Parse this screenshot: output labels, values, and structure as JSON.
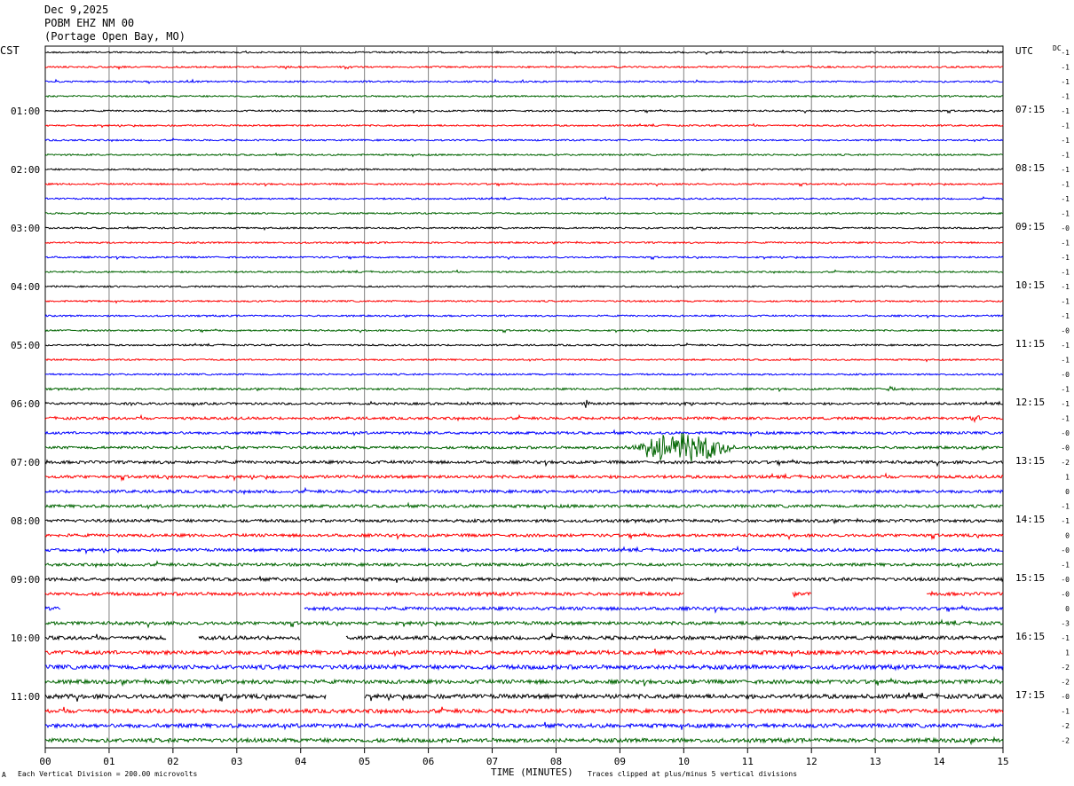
{
  "header": {
    "date": "Dec 9,2025",
    "station": "POBM EHZ NM 00",
    "location": "(Portage Open Bay, MO)"
  },
  "left_axis_label": "CST",
  "right_axis_label": "UTC",
  "dc_label": "DC",
  "footer": {
    "scale_note": "Each Vertical Division =  200.00 microvolts",
    "xlabel": "TIME (MINUTES)",
    "clip_note": "Traces clipped at plus/minus 5 vertical divisions",
    "corner_mark": "A"
  },
  "colors": {
    "trace_cycle": [
      "#000000",
      "#ff0000",
      "#0000ff",
      "#006400"
    ],
    "grid": "#808080",
    "background": "#ffffff"
  },
  "chart_data": {
    "type": "line",
    "xlabel": "TIME (MINUTES)",
    "xlim": [
      0,
      15
    ],
    "x_ticks": [
      "00",
      "01",
      "02",
      "03",
      "04",
      "05",
      "06",
      "07",
      "08",
      "09",
      "10",
      "11",
      "12",
      "13",
      "14",
      "15"
    ],
    "row_count": 48,
    "row_minutes": 15,
    "left_time_labels": [
      "01:00",
      "02:00",
      "03:00",
      "04:00",
      "05:00",
      "06:00",
      "07:00",
      "08:00",
      "09:00",
      "10:00",
      "11:00"
    ],
    "left_label_rows": [
      4,
      8,
      12,
      16,
      20,
      24,
      28,
      32,
      36,
      40,
      44
    ],
    "right_time_labels": [
      "UTC",
      "07:15",
      "08:15",
      "09:15",
      "10:15",
      "11:15",
      "12:15",
      "13:15",
      "14:15",
      "15:15",
      "16:15",
      "17:15"
    ],
    "right_label_rows": [
      0,
      4,
      8,
      12,
      16,
      20,
      24,
      28,
      32,
      36,
      40,
      44
    ],
    "dc_offsets": [
      "-1",
      "-1",
      "-1",
      "-1",
      "-1",
      "-1",
      "-1",
      "-1",
      "-1",
      "-1",
      "-1",
      "-1",
      "-0",
      "-1",
      "-1",
      "-1",
      "-1",
      "-1",
      "-1",
      "-0",
      "-1",
      "-1",
      "-0",
      "-1",
      "-1",
      "-1",
      "-0",
      "-0",
      "-2",
      "1",
      "0",
      "-1",
      "-1",
      "0",
      "-0",
      "-1",
      "-0",
      "-0",
      "0",
      "-3",
      "-1",
      "1",
      "-2",
      "-2",
      "-0",
      "-1",
      "-2",
      "-2"
    ],
    "noise_level": [
      1,
      1,
      1,
      1,
      1,
      1,
      1,
      1,
      1,
      1,
      1,
      1,
      1,
      1,
      1,
      1,
      1,
      1,
      1,
      1,
      1,
      1,
      1,
      1.2,
      1.4,
      1.6,
      1.6,
      1.6,
      1.8,
      1.8,
      1.8,
      1.8,
      1.8,
      1.8,
      1.8,
      1.8,
      2,
      2,
      2,
      2,
      2.2,
      2.4,
      2.6,
      2.4,
      2.6,
      2.4,
      2.4,
      2.4
    ],
    "events": [
      {
        "row": 27,
        "start_min": 9.05,
        "end_min": 10.85,
        "peak_divisions": 5
      },
      {
        "row": 24,
        "start_min": 8.4,
        "end_min": 8.55,
        "peak_divisions": 1.5
      },
      {
        "row": 24,
        "start_min": 9.9,
        "end_min": 10.15,
        "peak_divisions": 1.2
      },
      {
        "row": 25,
        "start_min": 14.45,
        "end_min": 14.7,
        "peak_divisions": 1.2
      },
      {
        "row": 23,
        "start_min": 13.15,
        "end_min": 13.35,
        "peak_divisions": 0.8
      }
    ],
    "gaps": [
      {
        "row": 38,
        "start_min": 0.25,
        "end_min": 4.05
      },
      {
        "row": 37,
        "start_min": 10.0,
        "end_min": 11.7
      },
      {
        "row": 37,
        "start_min": 12.0,
        "end_min": 13.8
      },
      {
        "row": 40,
        "start_min": 1.9,
        "end_min": 2.4
      },
      {
        "row": 40,
        "start_min": 4.0,
        "end_min": 4.7
      },
      {
        "row": 44,
        "start_min": 4.4,
        "end_min": 5.0
      }
    ]
  }
}
